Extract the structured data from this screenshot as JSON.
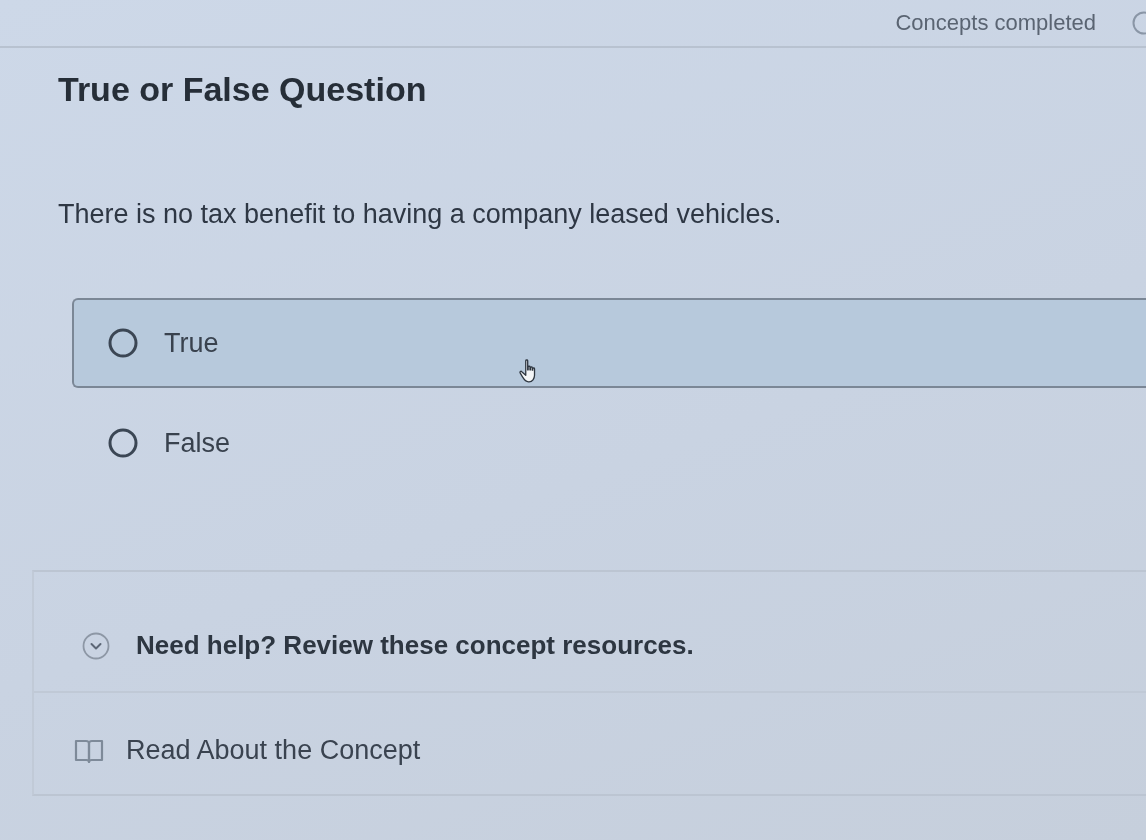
{
  "header": {
    "progress_label": "Concepts completed"
  },
  "question": {
    "type_label": "True or False Question",
    "prompt": "There is no tax benefit to having a company leased vehicles."
  },
  "options": [
    {
      "label": "True",
      "selected": false,
      "hovered": true
    },
    {
      "label": "False",
      "selected": false,
      "hovered": false
    }
  ],
  "help": {
    "heading": "Need help? Review these concept resources.",
    "expanded": true,
    "resources": [
      {
        "kind": "reading",
        "label": "Read About the Concept"
      }
    ]
  }
}
